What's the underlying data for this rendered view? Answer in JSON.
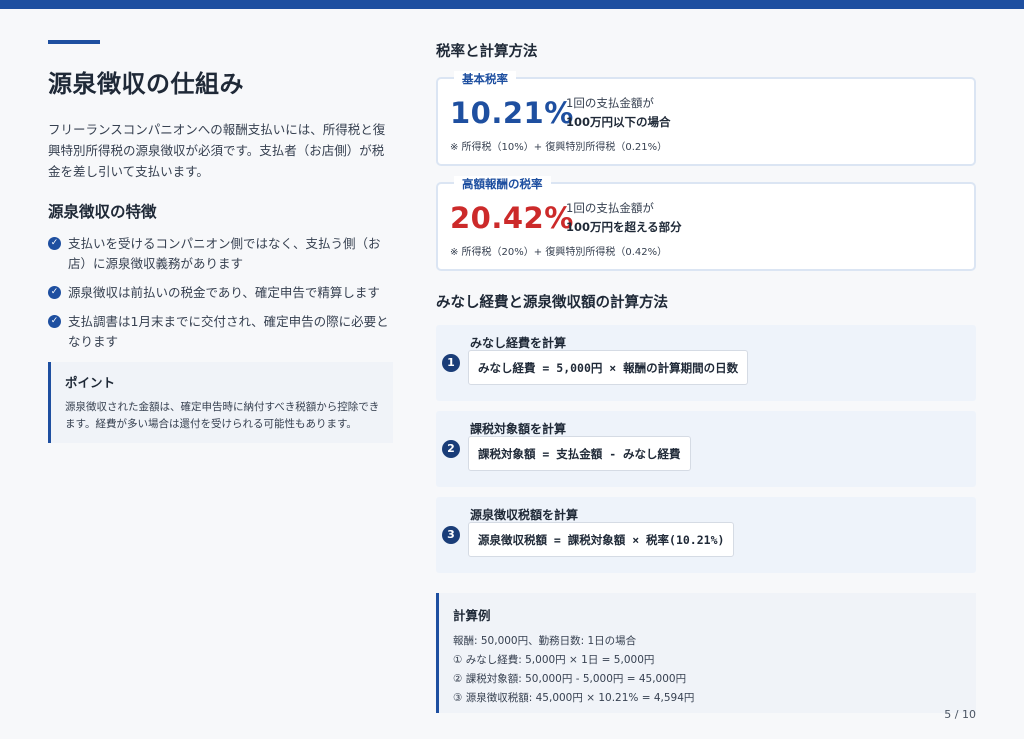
{
  "left": {
    "title": "源泉徴収の仕組み",
    "intro": "フリーランスコンパニオンへの報酬支払いには、所得税と復興特別所得税の源泉徴収が必須です。支払者（お店側）が税金を差し引いて支払います。",
    "features_title": "源泉徴収の特徴",
    "features": [
      "支払いを受けるコンパニオン側ではなく、支払う側（お店）に源泉徴収義務があります",
      "源泉徴収は前払いの税金であり、確定申告で精算します",
      "支払調書は1月末までに交付され、確定申告の際に必要となります"
    ],
    "point_title": "ポイント",
    "point_text": "源泉徴収された金額は、確定申告時に納付すべき税額から控除できます。経費が多い場合は還付を受けられる可能性もあります。"
  },
  "right": {
    "rates_title": "税率と計算方法",
    "rate1": {
      "tag": "基本税率",
      "value": "10.21%",
      "desc_line1": "1回の支払金額が",
      "desc_line2": "100万円以下の場合",
      "note": "※ 所得税（10%）+ 復興特別所得税（0.21%）"
    },
    "rate2": {
      "tag": "高額報酬の税率",
      "value": "20.42%",
      "desc_line1": "1回の支払金額が",
      "desc_line2": "100万円を超える部分",
      "note": "※ 所得税（20%）+ 復興特別所得税（0.42%）"
    },
    "calc_title": "みなし経費と源泉徴収額の計算方法",
    "steps": [
      {
        "num": "1",
        "label": "みなし経費を計算",
        "formula": "みなし経費 = 5,000円 × 報酬の計算期間の日数"
      },
      {
        "num": "2",
        "label": "課税対象額を計算",
        "formula": "課税対象額 = 支払金額 - みなし経費"
      },
      {
        "num": "3",
        "label": "源泉徴収税額を計算",
        "formula": "源泉徴収税額 = 課税対象額 × 税率(10.21%)"
      }
    ],
    "example": {
      "title": "計算例",
      "lines": [
        "報酬: 50,000円、勤務日数: 1日の場合",
        "① みなし経費: 5,000円 × 1日 = 5,000円",
        "② 課税対象額: 50,000円 - 5,000円 = 45,000円",
        "③ 源泉徴収税額: 45,000円 × 10.21% = 4,594円"
      ]
    }
  },
  "page": "5 / 10",
  "colors": {
    "accent": "#1e4fa0",
    "red": "#cc2a2a",
    "step_badge": "#1a3d78"
  },
  "icons": {
    "feature_bullet": "check-circle-icon"
  }
}
